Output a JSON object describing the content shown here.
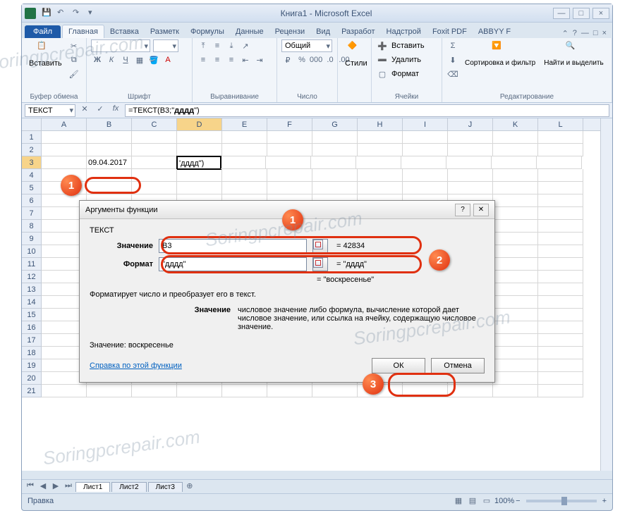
{
  "window": {
    "title": "Книга1 - Microsoft Excel"
  },
  "tabs": {
    "file": "Файл",
    "home": "Главная",
    "insert": "Вставка",
    "layout": "Разметк",
    "formulas": "Формулы",
    "data": "Данные",
    "review": "Рецензи",
    "view": "Вид",
    "dev": "Разработ",
    "addin": "Надстрой",
    "foxit": "Foxit PDF",
    "abbyy": "ABBYY F"
  },
  "ribbon": {
    "clipboard": {
      "label": "Буфер обмена",
      "paste": "Вставить"
    },
    "font": {
      "label": "Шрифт"
    },
    "align": {
      "label": "Выравнивание"
    },
    "number": {
      "label": "Число",
      "format": "Общий"
    },
    "styles": {
      "label": "Стили",
      "btn": "Стили"
    },
    "cells": {
      "label": "Ячейки",
      "insert": "Вставить",
      "delete": "Удалить",
      "format": "Формат"
    },
    "editing": {
      "label": "Редактирование",
      "sort": "Сортировка и фильтр",
      "find": "Найти и выделить"
    }
  },
  "namebox": "ТЕКСТ",
  "formula_parts": {
    "pre": "=ТЕКСТ(B3;\"",
    "bold": "дддд",
    "post": "\")"
  },
  "columns": [
    "A",
    "B",
    "C",
    "D",
    "E",
    "F",
    "G",
    "H",
    "I",
    "J",
    "K",
    "L"
  ],
  "row_count": 21,
  "cell_b3": "09.04.2017",
  "cell_d3": "'дддд\")",
  "sheets": [
    "Лист1",
    "Лист2",
    "Лист3"
  ],
  "status": "Правка",
  "zoom": "100%",
  "dialog": {
    "title": "Аргументы функции",
    "func": "ТЕКСТ",
    "arg1": {
      "label": "Значение",
      "value": "B3",
      "result": "= 42834"
    },
    "arg2": {
      "label": "Формат",
      "value": "\"дддд\"",
      "result": "= \"дддд\""
    },
    "computed": "= \"воскресенье\"",
    "desc": "Форматирует число и преобразует его в текст.",
    "arg_desc_label": "Значение",
    "arg_desc": "числовое значение либо формула, вычисление которой дает числовое значение, или ссылка на ячейку, содержащую числовое значение.",
    "value_label": "Значение:",
    "value_result": "воскресенье",
    "help": "Справка по этой функции",
    "ok": "ОК",
    "cancel": "Отмена"
  },
  "watermark": "Soringpcrepair.com"
}
